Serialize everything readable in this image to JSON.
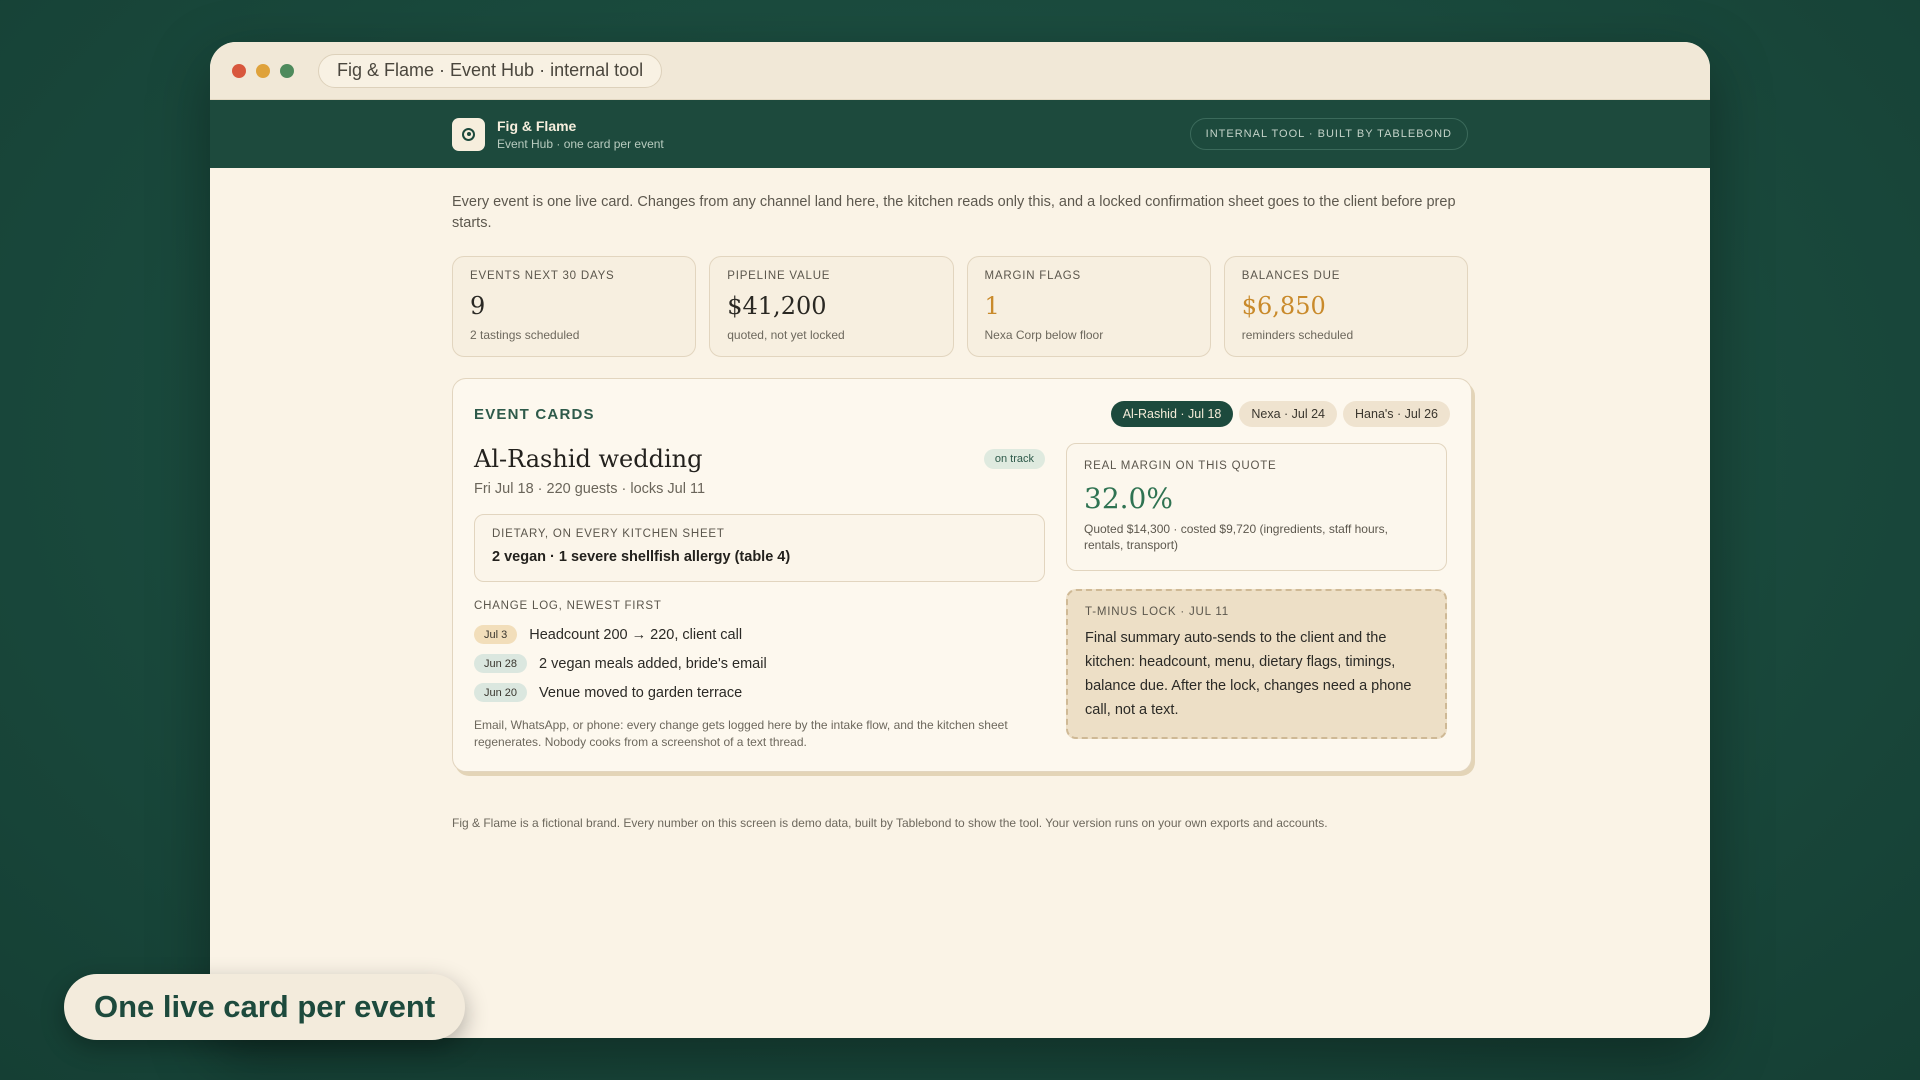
{
  "window": {
    "title": "Fig & Flame · Event Hub · internal tool"
  },
  "appbar": {
    "brand_name": "Fig & Flame",
    "brand_sub": "Event Hub · one card per event",
    "badge": "INTERNAL TOOL · BUILT BY TABLEBOND"
  },
  "intro": "Every event is one live card. Changes from any channel land here, the kitchen reads only this, and a locked confirmation sheet goes to the client before prep starts.",
  "stats": [
    {
      "label": "EVENTS NEXT 30 DAYS",
      "value": "9",
      "sub": "2 tastings scheduled"
    },
    {
      "label": "PIPELINE VALUE",
      "value": "$41,200",
      "sub": "quoted, not yet locked"
    },
    {
      "label": "MARGIN FLAGS",
      "value": "1",
      "sub": "Nexa Corp below floor"
    },
    {
      "label": "BALANCES DUE",
      "value": "$6,850",
      "sub": "reminders scheduled"
    }
  ],
  "colors": {
    "amber": "#c98a2b",
    "green_dark": "#1d4a3d",
    "margin_green": "#2f7352"
  },
  "panel": {
    "title": "EVENT CARDS",
    "tabs": [
      {
        "label": "Al-Rashid · Jul 18",
        "active": true
      },
      {
        "label": "Nexa · Jul 24",
        "active": false
      },
      {
        "label": "Hana's · Jul 26",
        "active": false
      }
    ],
    "event": {
      "title": "Al-Rashid wedding",
      "status": "on track",
      "sub": "Fri Jul 18 · 220 guests · locks Jul 11",
      "dietary_label": "DIETARY, ON EVERY KITCHEN SHEET",
      "dietary_text": "2 vegan · 1 severe shellfish allergy (table 4)",
      "log_label": "CHANGE LOG, NEWEST FIRST",
      "log": [
        {
          "date": "Jul 3",
          "text": "Headcount 200 → 220, client call"
        },
        {
          "date": "Jun 28",
          "text": "2 vegan meals added, bride's email"
        },
        {
          "date": "Jun 20",
          "text": "Venue moved to garden terrace"
        }
      ],
      "log_note": "Email, WhatsApp, or phone: every change gets logged here by the intake flow, and the kitchen sheet regenerates. Nobody cooks from a screenshot of a text thread."
    },
    "margin": {
      "label": "REAL MARGIN ON THIS QUOTE",
      "value": "32.0%",
      "note": "Quoted $14,300 · costed $9,720 (ingredients, staff hours, rentals, transport)"
    },
    "lock": {
      "label": "T-MINUS LOCK · JUL 11",
      "text": "Final summary auto-sends to the client and the kitchen: headcount, menu, dietary flags, timings, balance due. After the lock, changes need a phone call, not a text."
    }
  },
  "disclaimer": "Fig & Flame is a fictional brand. Every number on this screen is demo data, built by Tablebond to show the tool. Your version runs on your own exports and accounts.",
  "caption": "One live card per event",
  "icons": {
    "logo": "target-icon"
  }
}
